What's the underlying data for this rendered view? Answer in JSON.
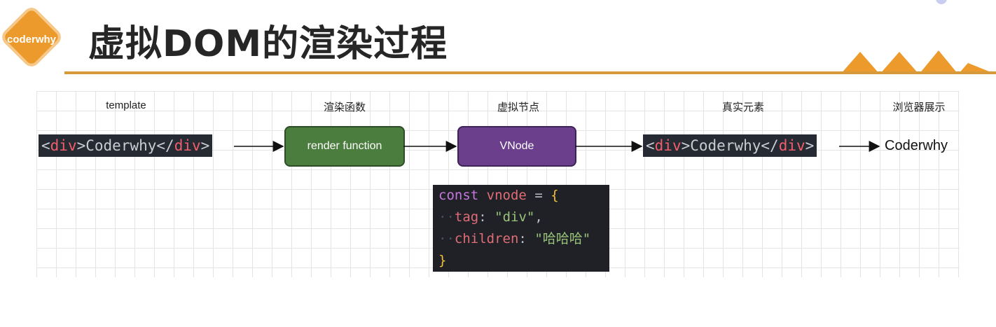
{
  "header": {
    "logo_text": "coderwhy",
    "title": "虚拟DOM的渲染过程",
    "accent_color": "#ec9a2c"
  },
  "diagram": {
    "columns": [
      {
        "label": "template"
      },
      {
        "label": "渲染函数"
      },
      {
        "label": "虚拟节点"
      },
      {
        "label": "真实元素"
      },
      {
        "label": "浏览器展示"
      }
    ],
    "template_chip": {
      "open_lt": "<",
      "open_tag": "div",
      "open_gt": ">",
      "text": "Coderwhy",
      "close_lt": "</",
      "close_tag": "div",
      "close_gt": ">"
    },
    "render_box": {
      "label": "render function",
      "color": "#4a7d3e"
    },
    "vnode_box": {
      "label": "VNode",
      "color": "#6b3f8c"
    },
    "element_chip": {
      "open_lt": "<",
      "open_tag": "div",
      "open_gt": ">",
      "text": "Coderwhy",
      "close_lt": "</",
      "close_tag": "div",
      "close_gt": ">"
    },
    "browser_output": "Coderwhy",
    "code": {
      "line1": {
        "keyword": "const",
        "name": "vnode",
        "op": "=",
        "brace": "{"
      },
      "line2": {
        "key": "tag",
        "colon": ":",
        "value": "\"div\"",
        "comma": ","
      },
      "line3": {
        "key": "children",
        "colon": ":",
        "value": "\"哈哈哈\""
      },
      "line4": {
        "brace": "}"
      }
    }
  }
}
